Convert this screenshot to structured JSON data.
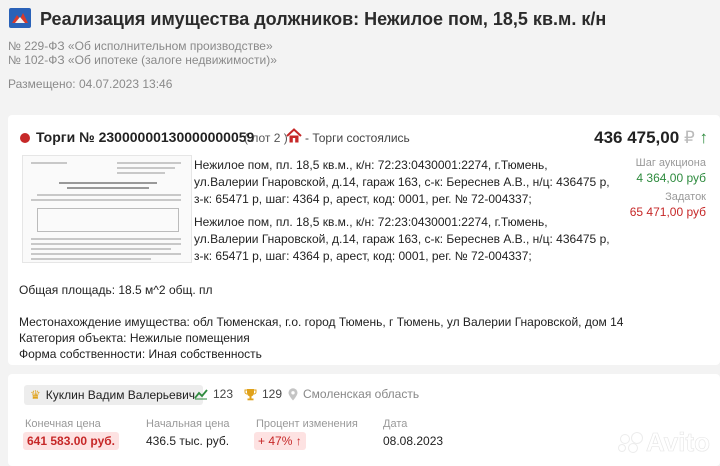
{
  "header": {
    "title": "Реализация имущества должников: Нежилое пом, 18,5 кв.м. к/н",
    "laws": [
      "№ 229-ФЗ «Об исполнительном производстве»",
      "№ 102-ФЗ «Об ипотеке (залоге недвижимости)»"
    ],
    "posted_label": "Размещено:",
    "posted_value": "04.07.2023 13:46"
  },
  "lot": {
    "title": "Торги № 23000000130000000059",
    "lot_count": "( лот 2 )",
    "status": "- Торги состоялись",
    "price": "436 475,00",
    "currency_symbol": "₽",
    "trend_symbol": "↑",
    "step_label": "Шаг аукциона",
    "step_value": "4 364,00 руб",
    "deposit_label": "Задаток",
    "deposit_value": "65 471,00 руб",
    "description_1": "Нежилое пом, пл. 18,5 кв.м., к/н: 72:23:0430001:2274, г.Тюмень, ул.Валерии Гнаровской, д.14, гараж 163, с-к: Береснев А.В., н/ц: 436475 р, з-к: 65471 р, шаг: 4364 р, арест, код: 0001, рег. № 72-004337;",
    "description_2": "Нежилое пом, пл. 18,5 кв.м., к/н: 72:23:0430001:2274, г.Тюмень, ул.Валерии Гнаровской, д.14, гараж 163, с-к: Береснев А.В., н/ц: 436475 р, з-к: 65471 р, шаг: 4364 р, арест, код: 0001, рег. № 72-004337;",
    "area": "Общая площадь: 18.5 м^2 общ. пл",
    "location": "Местонахождение имущества: обл Тюменская, г.о. город Тюмень, г Тюмень, ул Валерии Гнаровской, дом 14",
    "category": "Категория объекта: Нежилые помещения",
    "ownership": "Форма собственности: Иная собственность"
  },
  "result": {
    "winner": "Куклин Вадим Валерьевич",
    "views": "123",
    "favorites": "129",
    "region": "Смоленская область",
    "final_price_label": "Конечная цена",
    "final_price_value": "641 583.00 руб.",
    "start_price_label": "Начальная цена",
    "start_price_value": "436.5 тыс. руб.",
    "change_label": "Процент изменения",
    "change_value": "+ 47% ↑",
    "date_label": "Дата",
    "date_value": "08.08.2023"
  },
  "watermark": "Avito",
  "colors": {
    "accent_red": "#c62828",
    "accent_green": "#2e8b3e",
    "crown": "#e0a21b"
  },
  "icons": [
    "logo-icon",
    "house-icon",
    "crown-icon",
    "chart-icon",
    "trophy-icon",
    "location-pin-icon"
  ]
}
